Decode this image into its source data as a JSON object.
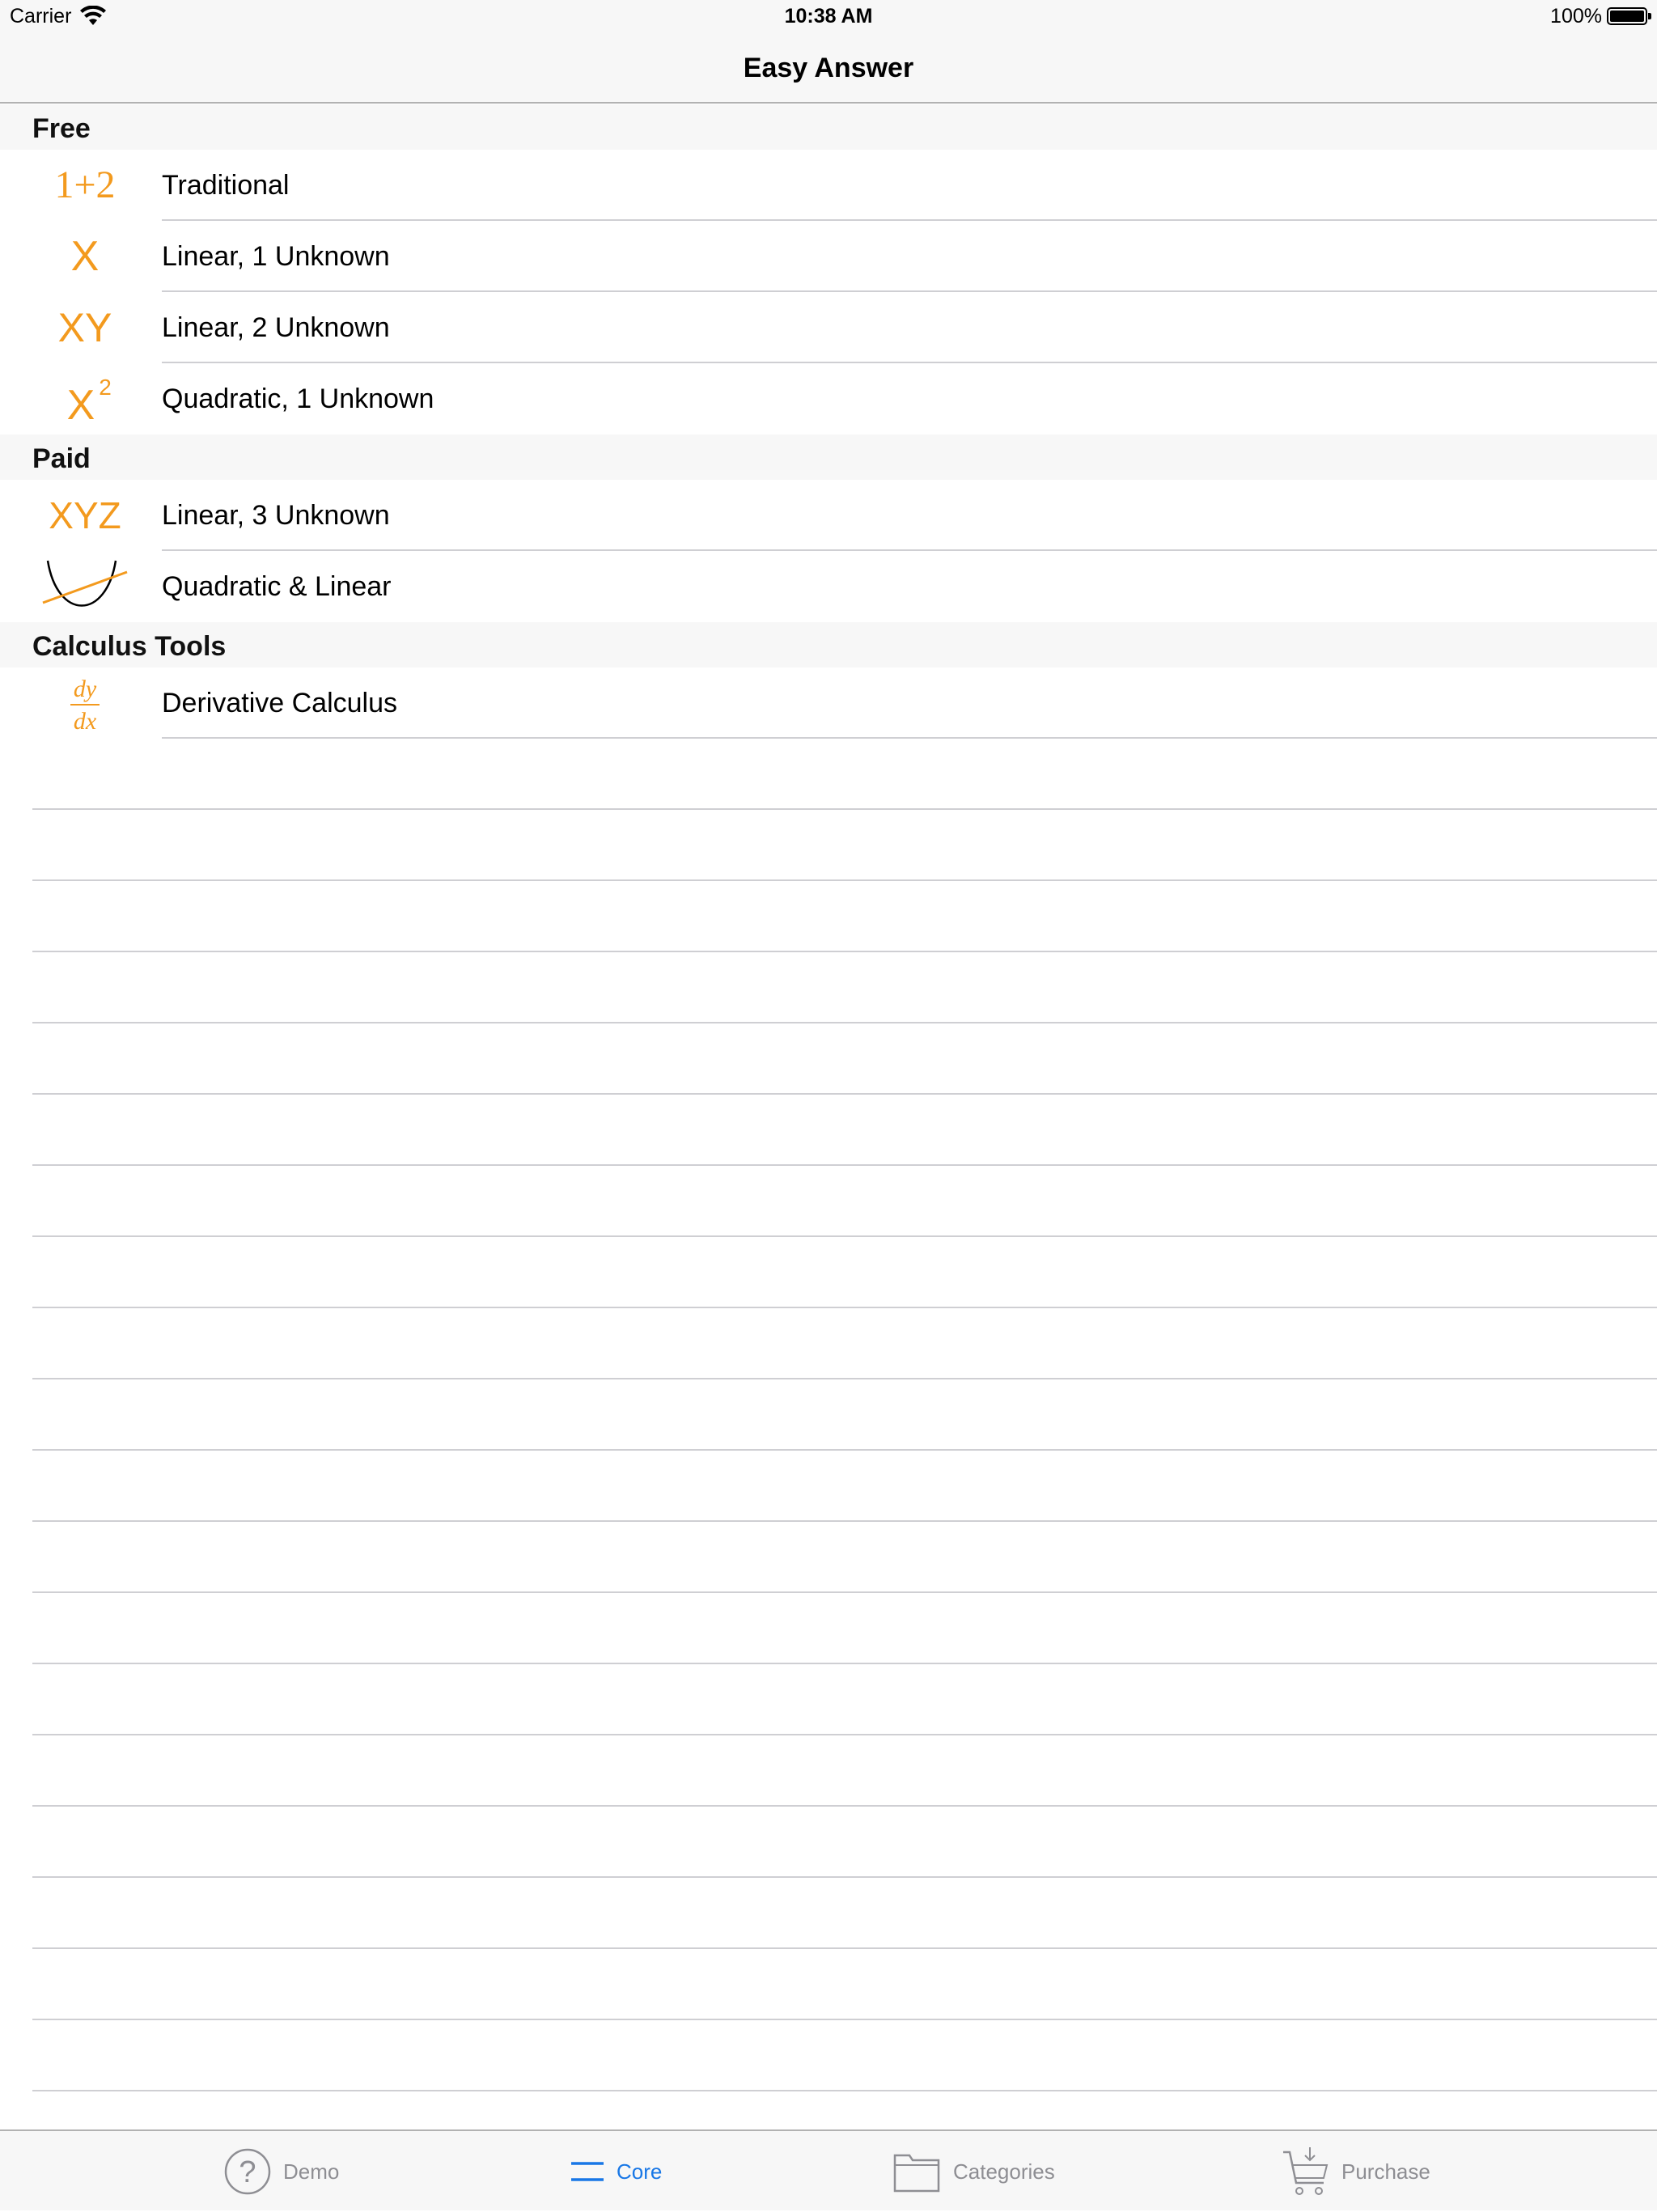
{
  "status_bar": {
    "carrier": "Carrier",
    "time": "10:38 AM",
    "battery": "100%"
  },
  "nav": {
    "title": "Easy Answer"
  },
  "sections": [
    {
      "header": "Free",
      "rows": [
        {
          "label": "Traditional",
          "icon": "one-plus-two-icon"
        },
        {
          "label": "Linear, 1 Unknown",
          "icon": "x-icon"
        },
        {
          "label": "Linear, 2 Unknown",
          "icon": "xy-icon"
        },
        {
          "label": "Quadratic, 1 Unknown",
          "icon": "x-squared-icon"
        }
      ]
    },
    {
      "header": "Paid",
      "rows": [
        {
          "label": "Linear, 3 Unknown",
          "icon": "xyz-icon"
        },
        {
          "label": "Quadratic & Linear",
          "icon": "parabola-line-icon"
        }
      ]
    },
    {
      "header": "Calculus Tools",
      "rows": [
        {
          "label": "Derivative Calculus",
          "icon": "dy-dx-icon"
        }
      ]
    }
  ],
  "icon_text": {
    "one_plus_two": "1+2",
    "x": "X",
    "xy": "XY",
    "x2_base": "X",
    "x2_exp": "2",
    "xyz": "XYZ",
    "dy": "dy",
    "dx": "dx"
  },
  "tabs": [
    {
      "label": "Demo",
      "icon": "question-circle-icon",
      "active": false
    },
    {
      "label": "Core",
      "icon": "menu-lines-icon",
      "active": true
    },
    {
      "label": "Categories",
      "icon": "folder-icon",
      "active": false
    },
    {
      "label": "Purchase",
      "icon": "cart-icon",
      "active": false
    }
  ],
  "colors": {
    "accent_orange": "#f39a1e",
    "tab_active": "#1877e6",
    "tab_inactive": "#8e8e93"
  }
}
